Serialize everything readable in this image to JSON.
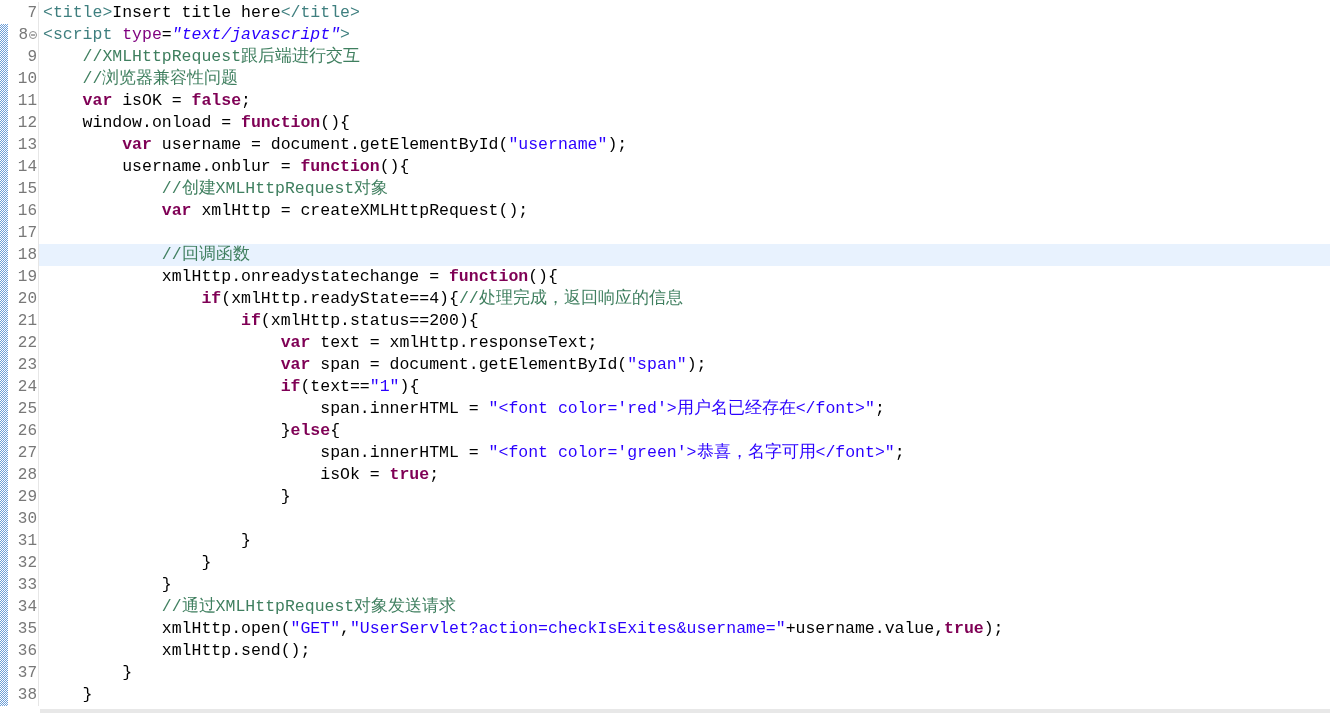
{
  "editor": {
    "lines": [
      {
        "number": "7",
        "changed": false,
        "current": false,
        "tokens": [
          {
            "kind": "tag",
            "text": "<title>"
          },
          {
            "kind": "plain",
            "text": "Insert title here"
          },
          {
            "kind": "tag",
            "text": "</title>"
          }
        ]
      },
      {
        "number": "8",
        "changed": true,
        "current": false,
        "foldable": true,
        "tokens": [
          {
            "kind": "tag",
            "text": "<script"
          },
          {
            "kind": "attr",
            "text": " type"
          },
          {
            "kind": "plain",
            "text": "="
          },
          {
            "kind": "value",
            "text": "\"text/javascript\""
          },
          {
            "kind": "tag",
            "text": ">"
          }
        ]
      },
      {
        "number": "9",
        "changed": true,
        "current": false,
        "tokens": [
          {
            "kind": "comment",
            "text": "    //XMLHttpRequest跟后端进行交互"
          }
        ]
      },
      {
        "number": "10",
        "changed": true,
        "current": false,
        "tokens": [
          {
            "kind": "comment",
            "text": "    //浏览器兼容性问题"
          }
        ]
      },
      {
        "number": "11",
        "changed": true,
        "current": false,
        "tokens": [
          {
            "kind": "keyword",
            "text": "    var"
          },
          {
            "kind": "plain",
            "text": " isOK = "
          },
          {
            "kind": "keyword",
            "text": "false"
          },
          {
            "kind": "plain",
            "text": ";"
          }
        ]
      },
      {
        "number": "12",
        "changed": true,
        "current": false,
        "tokens": [
          {
            "kind": "plain",
            "text": "    window.onload = "
          },
          {
            "kind": "keyword",
            "text": "function"
          },
          {
            "kind": "plain",
            "text": "(){"
          }
        ]
      },
      {
        "number": "13",
        "changed": true,
        "current": false,
        "tokens": [
          {
            "kind": "keyword",
            "text": "        var"
          },
          {
            "kind": "plain",
            "text": " username = document.getElementById("
          },
          {
            "kind": "string",
            "text": "\"username\""
          },
          {
            "kind": "plain",
            "text": ");"
          }
        ]
      },
      {
        "number": "14",
        "changed": true,
        "current": false,
        "tokens": [
          {
            "kind": "plain",
            "text": "        username.onblur = "
          },
          {
            "kind": "keyword",
            "text": "function"
          },
          {
            "kind": "plain",
            "text": "(){"
          }
        ]
      },
      {
        "number": "15",
        "changed": true,
        "current": false,
        "tokens": [
          {
            "kind": "comment",
            "text": "            //创建XMLHttpRequest对象"
          }
        ]
      },
      {
        "number": "16",
        "changed": true,
        "current": false,
        "tokens": [
          {
            "kind": "keyword",
            "text": "            var"
          },
          {
            "kind": "plain",
            "text": " xmlHttp = createXMLHttpRequest();"
          }
        ]
      },
      {
        "number": "17",
        "changed": true,
        "current": false
      },
      {
        "number": "18",
        "changed": true,
        "current": true,
        "tokens": [
          {
            "kind": "comment",
            "text": "            //回调函数"
          }
        ]
      },
      {
        "number": "19",
        "changed": true,
        "current": false,
        "tokens": [
          {
            "kind": "plain",
            "text": "            xmlHttp.onreadystatechange = "
          },
          {
            "kind": "keyword",
            "text": "function"
          },
          {
            "kind": "plain",
            "text": "(){"
          }
        ]
      },
      {
        "number": "20",
        "changed": true,
        "current": false,
        "tokens": [
          {
            "kind": "keyword",
            "text": "                if"
          },
          {
            "kind": "plain",
            "text": "(xmlHttp.readyState==4){"
          },
          {
            "kind": "comment",
            "text": "//处理完成，返回响应的信息"
          }
        ]
      },
      {
        "number": "21",
        "changed": true,
        "current": false,
        "tokens": [
          {
            "kind": "keyword",
            "text": "                    if"
          },
          {
            "kind": "plain",
            "text": "(xmlHttp.status==200){"
          }
        ]
      },
      {
        "number": "22",
        "changed": true,
        "current": false,
        "tokens": [
          {
            "kind": "keyword",
            "text": "                        var"
          },
          {
            "kind": "plain",
            "text": " text = xmlHttp.responseText;"
          }
        ]
      },
      {
        "number": "23",
        "changed": true,
        "current": false,
        "tokens": [
          {
            "kind": "keyword",
            "text": "                        var"
          },
          {
            "kind": "plain",
            "text": " span = document.getElementById("
          },
          {
            "kind": "string",
            "text": "\"span\""
          },
          {
            "kind": "plain",
            "text": ");"
          }
        ]
      },
      {
        "number": "24",
        "changed": true,
        "current": false,
        "tokens": [
          {
            "kind": "keyword",
            "text": "                        if"
          },
          {
            "kind": "plain",
            "text": "(text=="
          },
          {
            "kind": "string",
            "text": "\"1\""
          },
          {
            "kind": "plain",
            "text": "){"
          }
        ]
      },
      {
        "number": "25",
        "changed": true,
        "current": false,
        "tokens": [
          {
            "kind": "plain",
            "text": "                            span.innerHTML = "
          },
          {
            "kind": "string",
            "text": "\"<font color='red'>用户名已经存在</font>\""
          },
          {
            "kind": "plain",
            "text": ";"
          }
        ]
      },
      {
        "number": "26",
        "changed": true,
        "current": false,
        "tokens": [
          {
            "kind": "plain",
            "text": "                        }"
          },
          {
            "kind": "keyword",
            "text": "else"
          },
          {
            "kind": "plain",
            "text": "{"
          }
        ]
      },
      {
        "number": "27",
        "changed": true,
        "current": false,
        "tokens": [
          {
            "kind": "plain",
            "text": "                            span.innerHTML = "
          },
          {
            "kind": "string",
            "text": "\"<font color='green'>恭喜，名字可用</font>\""
          },
          {
            "kind": "plain",
            "text": ";"
          }
        ]
      },
      {
        "number": "28",
        "changed": true,
        "current": false,
        "tokens": [
          {
            "kind": "plain",
            "text": "                            isOk = "
          },
          {
            "kind": "keyword",
            "text": "true"
          },
          {
            "kind": "plain",
            "text": ";"
          }
        ]
      },
      {
        "number": "29",
        "changed": true,
        "current": false,
        "tokens": [
          {
            "kind": "plain",
            "text": "                        }"
          }
        ]
      },
      {
        "number": "30",
        "changed": true,
        "current": false
      },
      {
        "number": "31",
        "changed": true,
        "current": false,
        "tokens": [
          {
            "kind": "plain",
            "text": "                    }"
          }
        ]
      },
      {
        "number": "32",
        "changed": true,
        "current": false,
        "tokens": [
          {
            "kind": "plain",
            "text": "                }"
          }
        ]
      },
      {
        "number": "33",
        "changed": true,
        "current": false,
        "tokens": [
          {
            "kind": "plain",
            "text": "            }"
          }
        ]
      },
      {
        "number": "34",
        "changed": true,
        "current": false,
        "tokens": [
          {
            "kind": "comment",
            "text": "            //通过XMLHttpRequest对象发送请求"
          }
        ]
      },
      {
        "number": "35",
        "changed": true,
        "current": false,
        "tokens": [
          {
            "kind": "plain",
            "text": "            xmlHttp.open("
          },
          {
            "kind": "string",
            "text": "\"GET\""
          },
          {
            "kind": "plain",
            "text": ","
          },
          {
            "kind": "string",
            "text": "\"UserServlet?action=checkIsExites&username=\""
          },
          {
            "kind": "plain",
            "text": "+username.value,"
          },
          {
            "kind": "keyword",
            "text": "true"
          },
          {
            "kind": "plain",
            "text": ");"
          }
        ]
      },
      {
        "number": "36",
        "changed": true,
        "current": false,
        "tokens": [
          {
            "kind": "plain",
            "text": "            xmlHttp.send();"
          }
        ]
      },
      {
        "number": "37",
        "changed": true,
        "current": false,
        "tokens": [
          {
            "kind": "plain",
            "text": "        }"
          }
        ]
      },
      {
        "number": "38",
        "changed": true,
        "current": false,
        "tokens": [
          {
            "kind": "plain",
            "text": "    }"
          }
        ]
      }
    ]
  }
}
